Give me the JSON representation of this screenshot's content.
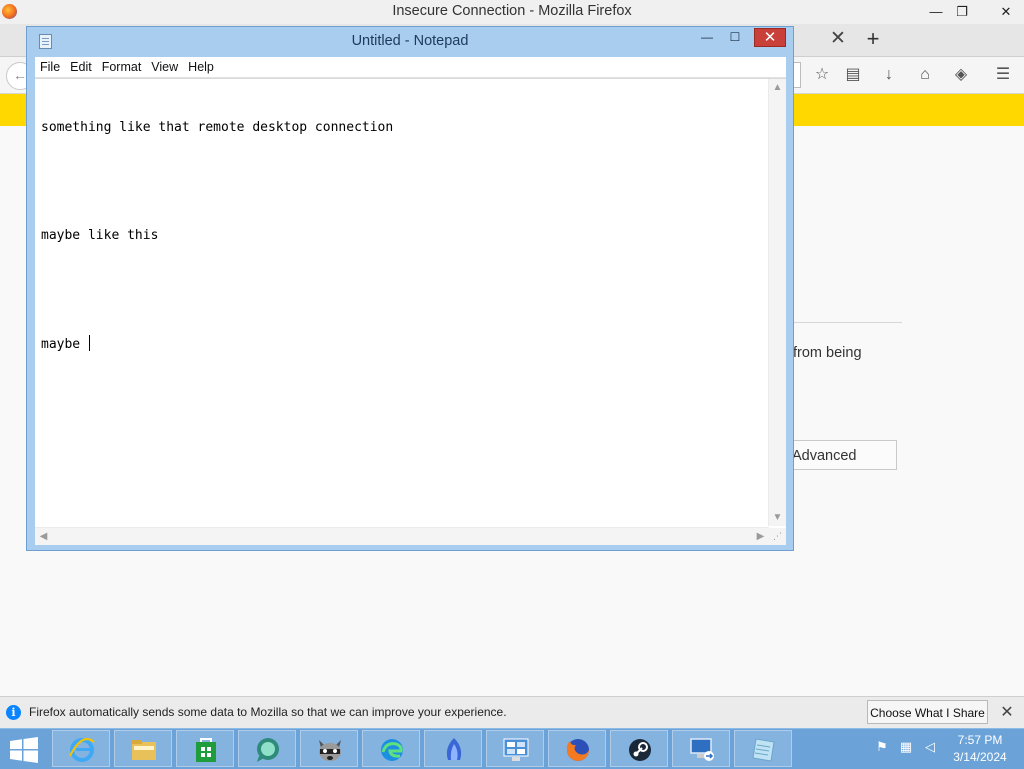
{
  "firefox": {
    "window_title": "Insecure Connection - Mozilla Firefox",
    "controls": {
      "minimize": "—",
      "restore": "❐",
      "close": "✕"
    },
    "tab_close": "✕",
    "new_tab": "+",
    "nav": {
      "back": "←",
      "bookmark_star": "☆",
      "reading_list": "▤",
      "download": "↓",
      "home": "⌂",
      "pocket": "◈",
      "menu": "☰"
    },
    "page": {
      "body_fragment": "from being",
      "advanced_button": "Advanced"
    },
    "notification": {
      "info_icon": "i",
      "text": "Firefox automatically sends some data to Mozilla so that we can improve your experience.",
      "button": "Choose What I Share",
      "close": "✕"
    },
    "colors": {
      "warning_bar": "#ffd800",
      "content_bg": "#f9f9fa"
    }
  },
  "notepad": {
    "title": "Untitled - Notepad",
    "controls": {
      "minimize": "—",
      "maximize": "☐",
      "close": "✕"
    },
    "menu": [
      "File",
      "Edit",
      "Format",
      "View",
      "Help"
    ],
    "lines": [
      "something like that remote desktop connection",
      "",
      "maybe like this",
      "",
      "maybe "
    ],
    "scroll": {
      "up": "▲",
      "down": "▼",
      "left": "◀",
      "right": "▶",
      "grip": "⋰"
    },
    "colors": {
      "frame": "#a9cdef",
      "close_button": "#c9403a"
    }
  },
  "taskbar": {
    "apps": [
      {
        "name": "internet-explorer-icon"
      },
      {
        "name": "file-explorer-icon"
      },
      {
        "name": "store-icon"
      },
      {
        "name": "chat-bubble-app-icon"
      },
      {
        "name": "raccoon-app-icon"
      },
      {
        "name": "edge-icon"
      },
      {
        "name": "blue-flame-app-icon"
      },
      {
        "name": "remote-desktop-manager-icon"
      },
      {
        "name": "firefox-icon"
      },
      {
        "name": "steam-icon"
      },
      {
        "name": "remote-desktop-connection-icon"
      },
      {
        "name": "notepad-icon"
      }
    ],
    "tray": {
      "flag": "⚑",
      "network": "▦",
      "volume": "◁"
    },
    "clock": {
      "time": "7:57 PM",
      "date": "3/14/2024"
    },
    "colors": {
      "bar": "#6ba3d9"
    }
  }
}
